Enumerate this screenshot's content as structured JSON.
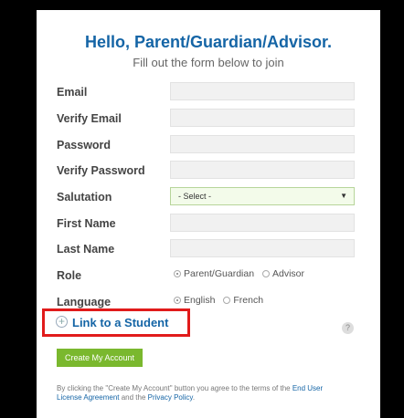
{
  "header": {
    "title": "Hello, Parent/Guardian/Advisor.",
    "subtitle": "Fill out the form below to join"
  },
  "form": {
    "email_label": "Email",
    "verify_email_label": "Verify Email",
    "password_label": "Password",
    "verify_password_label": "Verify Password",
    "salutation_label": "Salutation",
    "salutation_value": "- Select -",
    "first_name_label": "First Name",
    "last_name_label": "Last Name",
    "role_label": "Role",
    "role_options": [
      "Parent/Guardian",
      "Advisor"
    ],
    "role_selected": "Parent/Guardian",
    "language_label": "Language",
    "language_options": [
      "English",
      "French"
    ],
    "language_selected": "English"
  },
  "link_student": {
    "label": "Link to a Student"
  },
  "create_button": {
    "label": "Create My Account"
  },
  "terms": {
    "text_before": "By clicking the \"Create My Account\" button you agree to the terms of the ",
    "eula_link": "End User License Agreement",
    "text_middle": " and the ",
    "privacy_link": "Privacy Policy",
    "text_after": "."
  },
  "colors": {
    "accent": "#1565a6",
    "button": "#7ab82e",
    "highlight_border": "#e11b1b"
  }
}
